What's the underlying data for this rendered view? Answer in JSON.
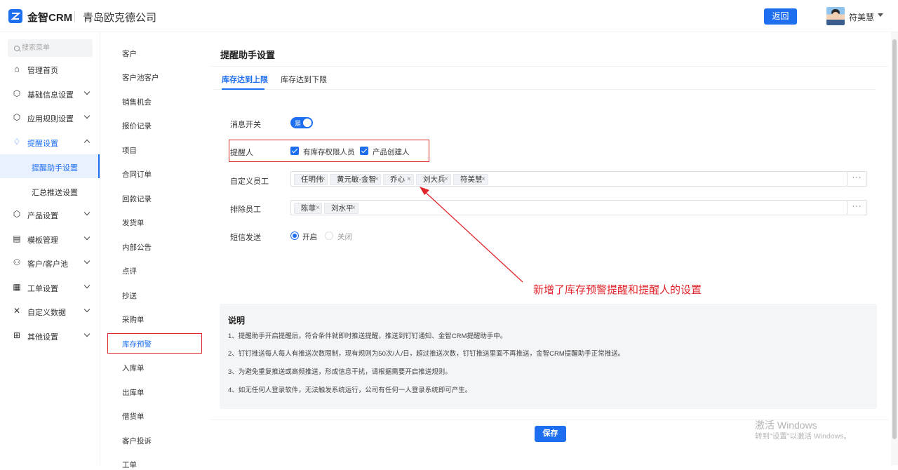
{
  "header": {
    "brand": "金智CRM",
    "company": "青岛欧克德公司",
    "back_label": "返回",
    "username": "符美慧"
  },
  "sidebar": {
    "search_placeholder": "搜索菜单",
    "items": [
      {
        "label": "管理首页",
        "icon": "home-icon"
      },
      {
        "label": "基础信息设置",
        "icon": "cube-icon"
      },
      {
        "label": "应用规则设置",
        "icon": "cube-icon"
      },
      {
        "label": "提醒设置",
        "icon": "bell-icon"
      },
      {
        "label": "产品设置",
        "icon": "cube-icon"
      },
      {
        "label": "模板管理",
        "icon": "template-icon"
      },
      {
        "label": "客户/客户池",
        "icon": "user-icon"
      },
      {
        "label": "工单设置",
        "icon": "document-icon"
      },
      {
        "label": "自定义数据",
        "icon": "tools-icon"
      },
      {
        "label": "其他设置",
        "icon": "grid-icon"
      }
    ],
    "submenu": [
      {
        "label": "提醒助手设置"
      },
      {
        "label": "汇总推送设置"
      }
    ]
  },
  "col2": {
    "items": [
      "客户",
      "客户池客户",
      "销售机会",
      "报价记录",
      "项目",
      "合同订单",
      "回款记录",
      "发货单",
      "内部公告",
      "点评",
      "抄送",
      "采购单",
      "库存预警",
      "入库单",
      "出库单",
      "借货单",
      "客户投诉",
      "工单"
    ],
    "selected": "库存预警"
  },
  "main": {
    "title": "提醒助手设置",
    "tabs": [
      "库存达到上限",
      "库存达到下限"
    ],
    "form": {
      "msg_switch_label": "消息开关",
      "msg_switch_text": "是",
      "reminder_label": "提醒人",
      "reminder_options": [
        "有库存权限人员",
        "产品创建人"
      ],
      "custom_label": "自定义员工",
      "custom_tags": [
        "任明伟",
        "黄元敏-金智",
        "乔心",
        "刘大兵",
        "符美慧"
      ],
      "exclude_label": "排除员工",
      "exclude_tags": [
        "陈菲",
        "刘水平"
      ],
      "more_label": "···",
      "sms_label": "短信发送",
      "sms_on": "开启",
      "sms_off": "关闭"
    },
    "annotation": "新增了库存预警提醒和提醒人的设置",
    "notes": {
      "title": "说明",
      "lines": [
        "1、提醒助手开启提醒后，符合条件就即时推送提醒，推送到钉钉通知、金智CRM提醒助手中。",
        "2、钉钉推送每人每人有推送次数限制，现有规则为50次/人/日，超过推送次数，钉钉推送里面不再推送，金智CRM提醒助手正常推送。",
        "3、为避免重复推送或高频推送，形成信息干扰，请根据需要开启推送规则。",
        "4、如无任何人登录软件，无法触发系统运行，公司有任何一人登录系统即可产生。"
      ]
    },
    "save_label": "保存"
  },
  "watermark": {
    "line1": "激活 Windows",
    "line2": "转到\"设置\"以激活 Windows。"
  },
  "colors": {
    "accent": "#1e6ff0",
    "highlight": "#e0242b"
  }
}
